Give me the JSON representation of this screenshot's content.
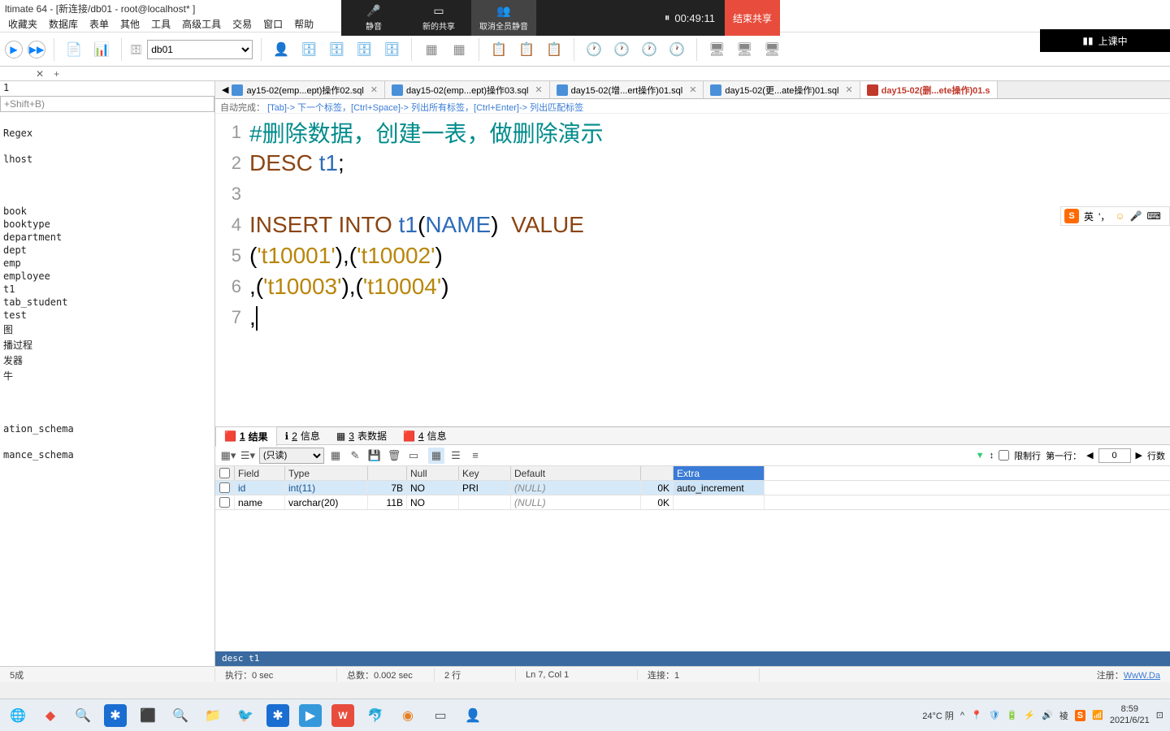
{
  "window": {
    "title": "ltimate 64 - [新连接/db01 - root@localhost* ]"
  },
  "menubar": [
    "收藏夹",
    "数据库",
    "表单",
    "其他",
    "工具",
    "高级工具",
    "交易",
    "窗口",
    "帮助"
  ],
  "toolbar": {
    "db_selected": "db01"
  },
  "conference": {
    "mute": "静音",
    "newshare": "新的共享",
    "stopmute": "取消全员静音",
    "time": "00:49:11",
    "end": "结束共享"
  },
  "class_badge": "上课中",
  "ime": {
    "lang": "英"
  },
  "sidebar": {
    "line1": "1",
    "filter_hint": "+Shift+B)",
    "regex": "Regex",
    "host": "lhost",
    "tables": [
      "book",
      "booktype",
      "department",
      "dept",
      "emp",
      "employee",
      "t1",
      "tab_student",
      "test",
      "图",
      "播过程",
      "发器",
      "牛"
    ],
    "schemas": [
      "ation_schema",
      "mance_schema"
    ]
  },
  "file_tabs": [
    {
      "label": "ay15-02(emp...ept)操作02.sql",
      "active": false
    },
    {
      "label": "day15-02(emp...ept)操作03.sql",
      "active": false
    },
    {
      "label": "day15-02(增...ert操作)01.sql",
      "active": false
    },
    {
      "label": "day15-02(更...ate操作)01.sql",
      "active": false
    },
    {
      "label": "day15-02(删...ete操作)01.s",
      "active": true
    }
  ],
  "hintbar": {
    "prefix": "自动完成：",
    "p1": "[Tab]-> 下一个标签，[Ctrl+Space]-> 列出所有标签，[Ctrl+Enter]-> 列出匹配标签"
  },
  "code": {
    "lines": [
      {
        "n": "1",
        "seg": [
          {
            "t": "#删除数据，创建一表，做删除演示",
            "c": "kw-cyan"
          }
        ]
      },
      {
        "n": "2",
        "seg": [
          {
            "t": "DESC",
            "c": "kw-brown"
          },
          {
            "t": " "
          },
          {
            "t": "t1",
            "c": "kw-blue"
          },
          {
            "t": ";"
          }
        ]
      },
      {
        "n": "3",
        "seg": []
      },
      {
        "n": "4",
        "seg": [
          {
            "t": "INSERT",
            "c": "kw-brown"
          },
          {
            "t": " "
          },
          {
            "t": "INTO",
            "c": "kw-brown"
          },
          {
            "t": " "
          },
          {
            "t": "t1",
            "c": "kw-blue"
          },
          {
            "t": "("
          },
          {
            "t": "NAME",
            "c": "kw-blue"
          },
          {
            "t": ")  "
          },
          {
            "t": "VALUE",
            "c": "kw-brown"
          }
        ]
      },
      {
        "n": "5",
        "seg": [
          {
            "t": "("
          },
          {
            "t": "'t10001'",
            "c": "str"
          },
          {
            "t": "),("
          },
          {
            "t": "'t10002'",
            "c": "str"
          },
          {
            "t": ")"
          }
        ]
      },
      {
        "n": "6",
        "seg": [
          {
            "t": ",("
          },
          {
            "t": "'t10003'",
            "c": "str"
          },
          {
            "t": "),("
          },
          {
            "t": "'t10004'",
            "c": "str"
          },
          {
            "t": ")"
          }
        ]
      },
      {
        "n": "7",
        "seg": [
          {
            "t": ","
          }
        ],
        "cursor": true
      }
    ]
  },
  "results": {
    "tabs": [
      {
        "num": "1",
        "label": "结果",
        "active": true
      },
      {
        "num": "2",
        "label": "信息",
        "active": false
      },
      {
        "num": "3",
        "label": "表数据",
        "active": false
      },
      {
        "num": "4",
        "label": "信息",
        "active": false
      }
    ],
    "mode": "(只读)",
    "limit_label": "限制行",
    "firstrow_label": "第一行：",
    "firstrow_value": "0",
    "rowcount_label": "行数",
    "headers": [
      "",
      "Field",
      "Type",
      "",
      "Null",
      "Key",
      "Default",
      "",
      "Extra"
    ],
    "rows": [
      {
        "field": "id",
        "type": "int(11)",
        "size": "7B",
        "null": "NO",
        "key": "PRI",
        "def": "(NULL)",
        "ok": "0K",
        "extra": "auto_increment",
        "sel": true
      },
      {
        "field": "name",
        "type": "varchar(20)",
        "size": "11B",
        "null": "NO",
        "key": "",
        "def": "(NULL)",
        "ok": "0K",
        "extra": "",
        "sel": false
      }
    ]
  },
  "sql_echo": "desc t1",
  "statusbar": {
    "left": "5成",
    "exec": "执行：0 sec",
    "total": "总数：0.002 sec",
    "rows": "2 行",
    "pos": "Ln 7, Col 1",
    "conn": "连接：1",
    "reg": "注册：",
    "reg_link": "WwW.Da"
  },
  "taskbar": {
    "weather": "24°C 阴",
    "time": "8:59",
    "date": "2021/6/21"
  }
}
